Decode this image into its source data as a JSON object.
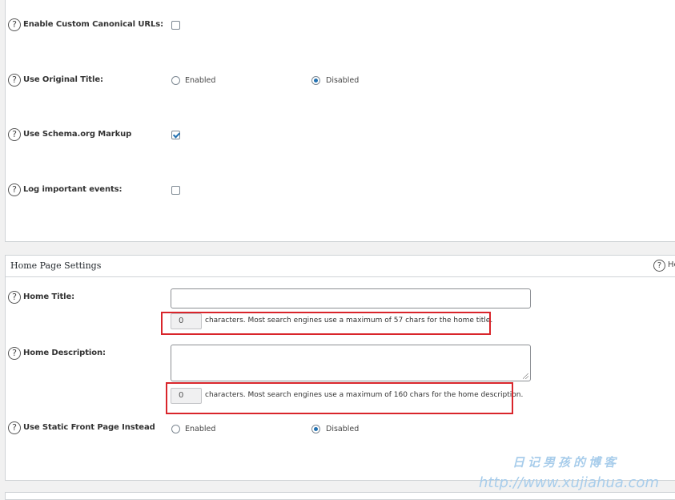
{
  "general_settings": {
    "rows": [
      {
        "label": "Enable Custom Canonical URLs:",
        "type": "checkbox",
        "checked": false
      },
      {
        "label": "Use Original Title:",
        "type": "radio",
        "options": [
          "Enabled",
          "Disabled"
        ],
        "selected": "Disabled"
      },
      {
        "label": "Use Schema.org Markup",
        "type": "checkbox",
        "checked": true
      },
      {
        "label": "Log important events:",
        "type": "checkbox",
        "checked": false
      }
    ]
  },
  "home_page_settings": {
    "title": "Home Page Settings",
    "help_text": "He",
    "home_title": {
      "label": "Home Title:",
      "value": "",
      "counter": "0",
      "counter_text": "characters. Most search engines use a maximum of 57 chars for the home title."
    },
    "home_description": {
      "label": "Home Description:",
      "value": "",
      "counter": "0",
      "counter_text": "characters. Most search engines use a maximum of 160 chars for the home description."
    },
    "static_front_page": {
      "label": "Use Static Front Page Instead",
      "options": [
        "Enabled",
        "Disabled"
      ],
      "selected": "Disabled"
    }
  },
  "help_icon_glyph": "?",
  "watermark": {
    "cn": "日记男孩的博客",
    "url": "http://www.xujiahua.com"
  },
  "colors": {
    "highlight": "#d9252b",
    "accent": "#2271b1",
    "watermark": "#a8cdeb"
  }
}
